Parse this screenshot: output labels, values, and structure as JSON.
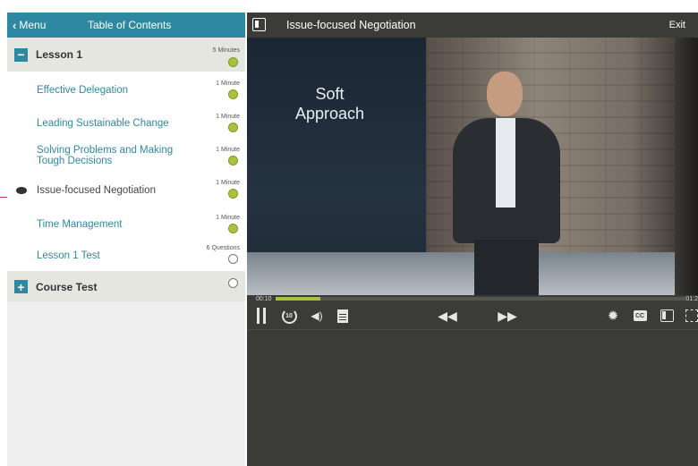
{
  "sidebar": {
    "menu_label": "Menu",
    "menu_chevron": "‹",
    "title": "Table of Contents",
    "lesson1": {
      "title": "Lesson 1",
      "duration": "5 Minutes",
      "status": "complete",
      "items": [
        {
          "label": "Effective Delegation",
          "duration": "1 Minute",
          "status": "complete",
          "active": false
        },
        {
          "label": "Leading Sustainable Change",
          "duration": "1 Minute",
          "status": "complete",
          "active": false
        },
        {
          "label": "Solving Problems and Making Tough Decisions",
          "duration": "1 Minute",
          "status": "complete",
          "active": false
        },
        {
          "label": "Issue-focused Negotiation",
          "duration": "1 Minute",
          "status": "complete",
          "active": true
        },
        {
          "label": "Time Management",
          "duration": "1 Minute",
          "status": "complete",
          "active": false
        },
        {
          "label": "Lesson 1 Test",
          "duration": "6 Questions",
          "status": "incomplete",
          "active": false
        }
      ]
    },
    "course_test": {
      "title": "Course Test",
      "status": "incomplete"
    }
  },
  "main": {
    "title": "Issue-focused Negotiation",
    "exit_label": "Exit",
    "video_text_line1": "Soft",
    "video_text_line2": "Approach"
  },
  "player": {
    "current_time": "00:10",
    "total_time": "01:2",
    "progress_fraction": 0.11,
    "replay_seconds": "10",
    "cc_label": "CC"
  },
  "colors": {
    "accent": "#2f88a2",
    "complete": "#a9c23e",
    "player_bg": "#3b3c37",
    "pointer": "#c8326b"
  },
  "icons": {
    "collapse": "minus-box-icon",
    "expand": "plus-box-icon",
    "panel_toggle": "panel-toggle-icon",
    "pause": "pause-icon",
    "replay": "replay-10-icon",
    "volume": "volume-icon",
    "transcript": "document-icon",
    "rewind": "rewind-icon",
    "forward": "fast-forward-icon",
    "settings": "gear-icon",
    "captions": "cc-icon",
    "fullscreen": "fullscreen-icon"
  }
}
